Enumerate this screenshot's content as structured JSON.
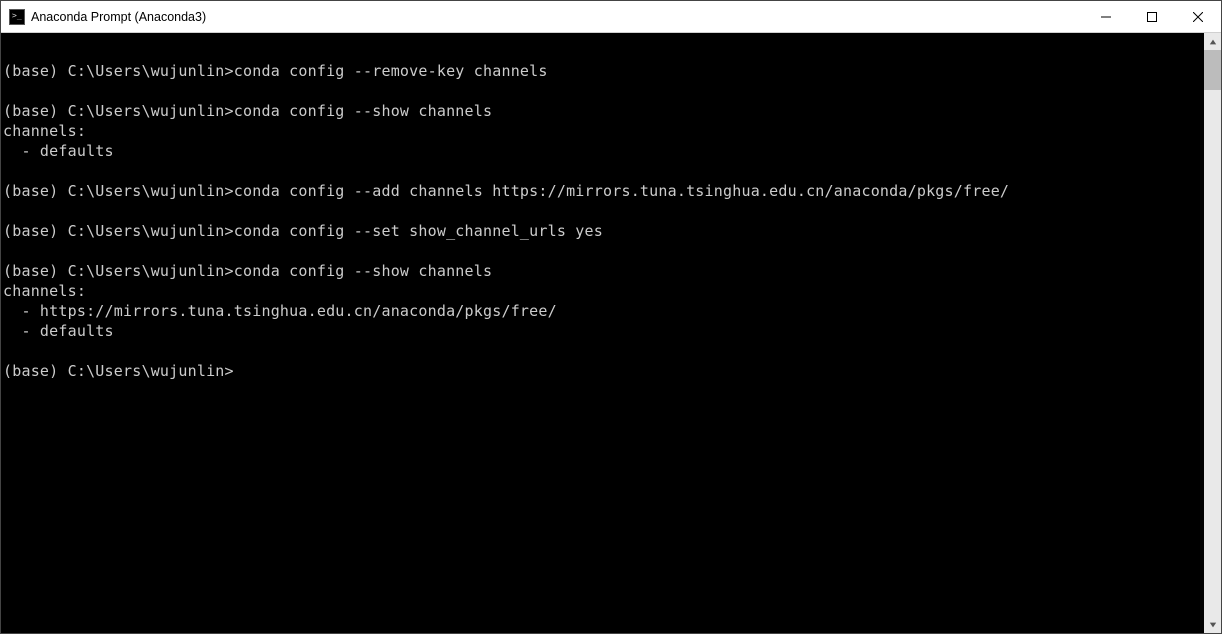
{
  "window": {
    "title": "Anaconda Prompt (Anaconda3)"
  },
  "terminal": {
    "prompt_env": "(base)",
    "prompt_path": "C:\\Users\\wujunlin>",
    "lines": [
      {
        "type": "blank"
      },
      {
        "type": "cmd",
        "text": "conda config --remove-key channels"
      },
      {
        "type": "blank"
      },
      {
        "type": "cmd",
        "text": "conda config --show channels"
      },
      {
        "type": "out",
        "text": "channels:"
      },
      {
        "type": "out",
        "text": "  - defaults"
      },
      {
        "type": "blank"
      },
      {
        "type": "cmd",
        "text": "conda config --add channels https://mirrors.tuna.tsinghua.edu.cn/anaconda/pkgs/free/"
      },
      {
        "type": "blank"
      },
      {
        "type": "cmd",
        "text": "conda config --set show_channel_urls yes"
      },
      {
        "type": "blank"
      },
      {
        "type": "cmd",
        "text": "conda config --show channels"
      },
      {
        "type": "out",
        "text": "channels:"
      },
      {
        "type": "out",
        "text": "  - https://mirrors.tuna.tsinghua.edu.cn/anaconda/pkgs/free/"
      },
      {
        "type": "out",
        "text": "  - defaults"
      },
      {
        "type": "blank"
      },
      {
        "type": "cmd",
        "text": ""
      }
    ]
  }
}
